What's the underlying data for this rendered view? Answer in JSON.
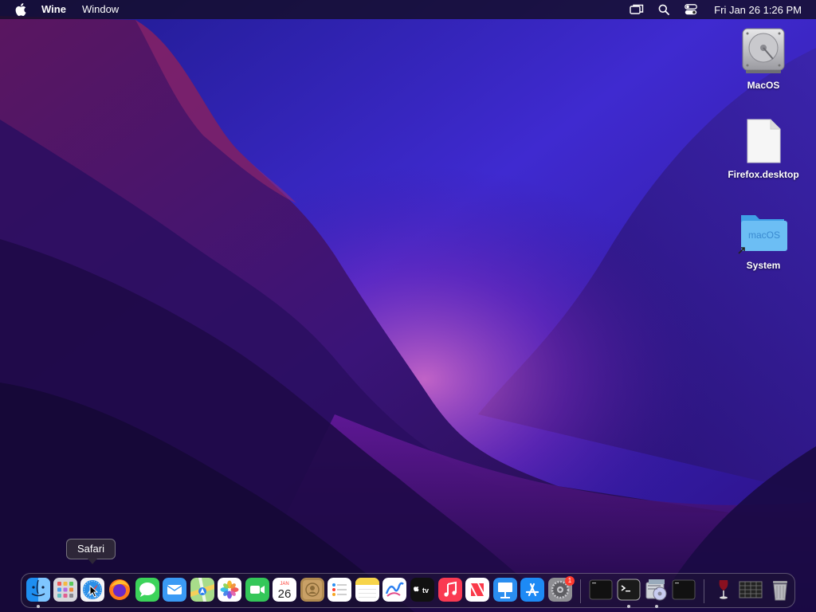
{
  "menubar": {
    "apple_icon": "apple-logo-icon",
    "app_name": "Wine",
    "menus": [
      "Window"
    ],
    "status_icons": [
      "screen-mirroring-icon",
      "spotlight-search-icon",
      "control-center-icon"
    ],
    "clock": "Fri Jan 26  1:26 PM"
  },
  "desktop": {
    "icons": [
      {
        "label": "MacOS",
        "icon": "hard-drive-icon"
      },
      {
        "label": "Firefox.desktop",
        "icon": "document-file-icon"
      },
      {
        "label": "System",
        "icon": "folder-alias-icon",
        "folder_text": "macOS"
      }
    ]
  },
  "tooltip": {
    "text": "Safari"
  },
  "dock": {
    "calendar": {
      "month": "JAN",
      "day": "26"
    },
    "appletv_label": "tv",
    "settings_badge": "1",
    "apps": [
      "finder-icon",
      "launchpad-icon",
      "safari-icon",
      "firefox-icon",
      "messages-icon",
      "mail-icon",
      "maps-icon",
      "photos-icon",
      "facetime-icon",
      "calendar-icon",
      "contacts-icon",
      "reminders-icon",
      "notes-icon",
      "freeform-icon",
      "apple-tv-icon",
      "music-icon",
      "news-icon",
      "keynote-icon",
      "app-store-icon",
      "system-settings-icon",
      "terminal-icon",
      "terminal-icon",
      "wine-tools-icon",
      "terminal-icon",
      "wine-icon",
      "grid-app-icon",
      "trash-icon"
    ]
  },
  "colors": {
    "wallpaper_deep": "#1a0b4a",
    "wallpaper_purple": "#5b20b0",
    "wallpaper_magenta": "#9b1d8a",
    "badge_red": "#ff3b30"
  }
}
